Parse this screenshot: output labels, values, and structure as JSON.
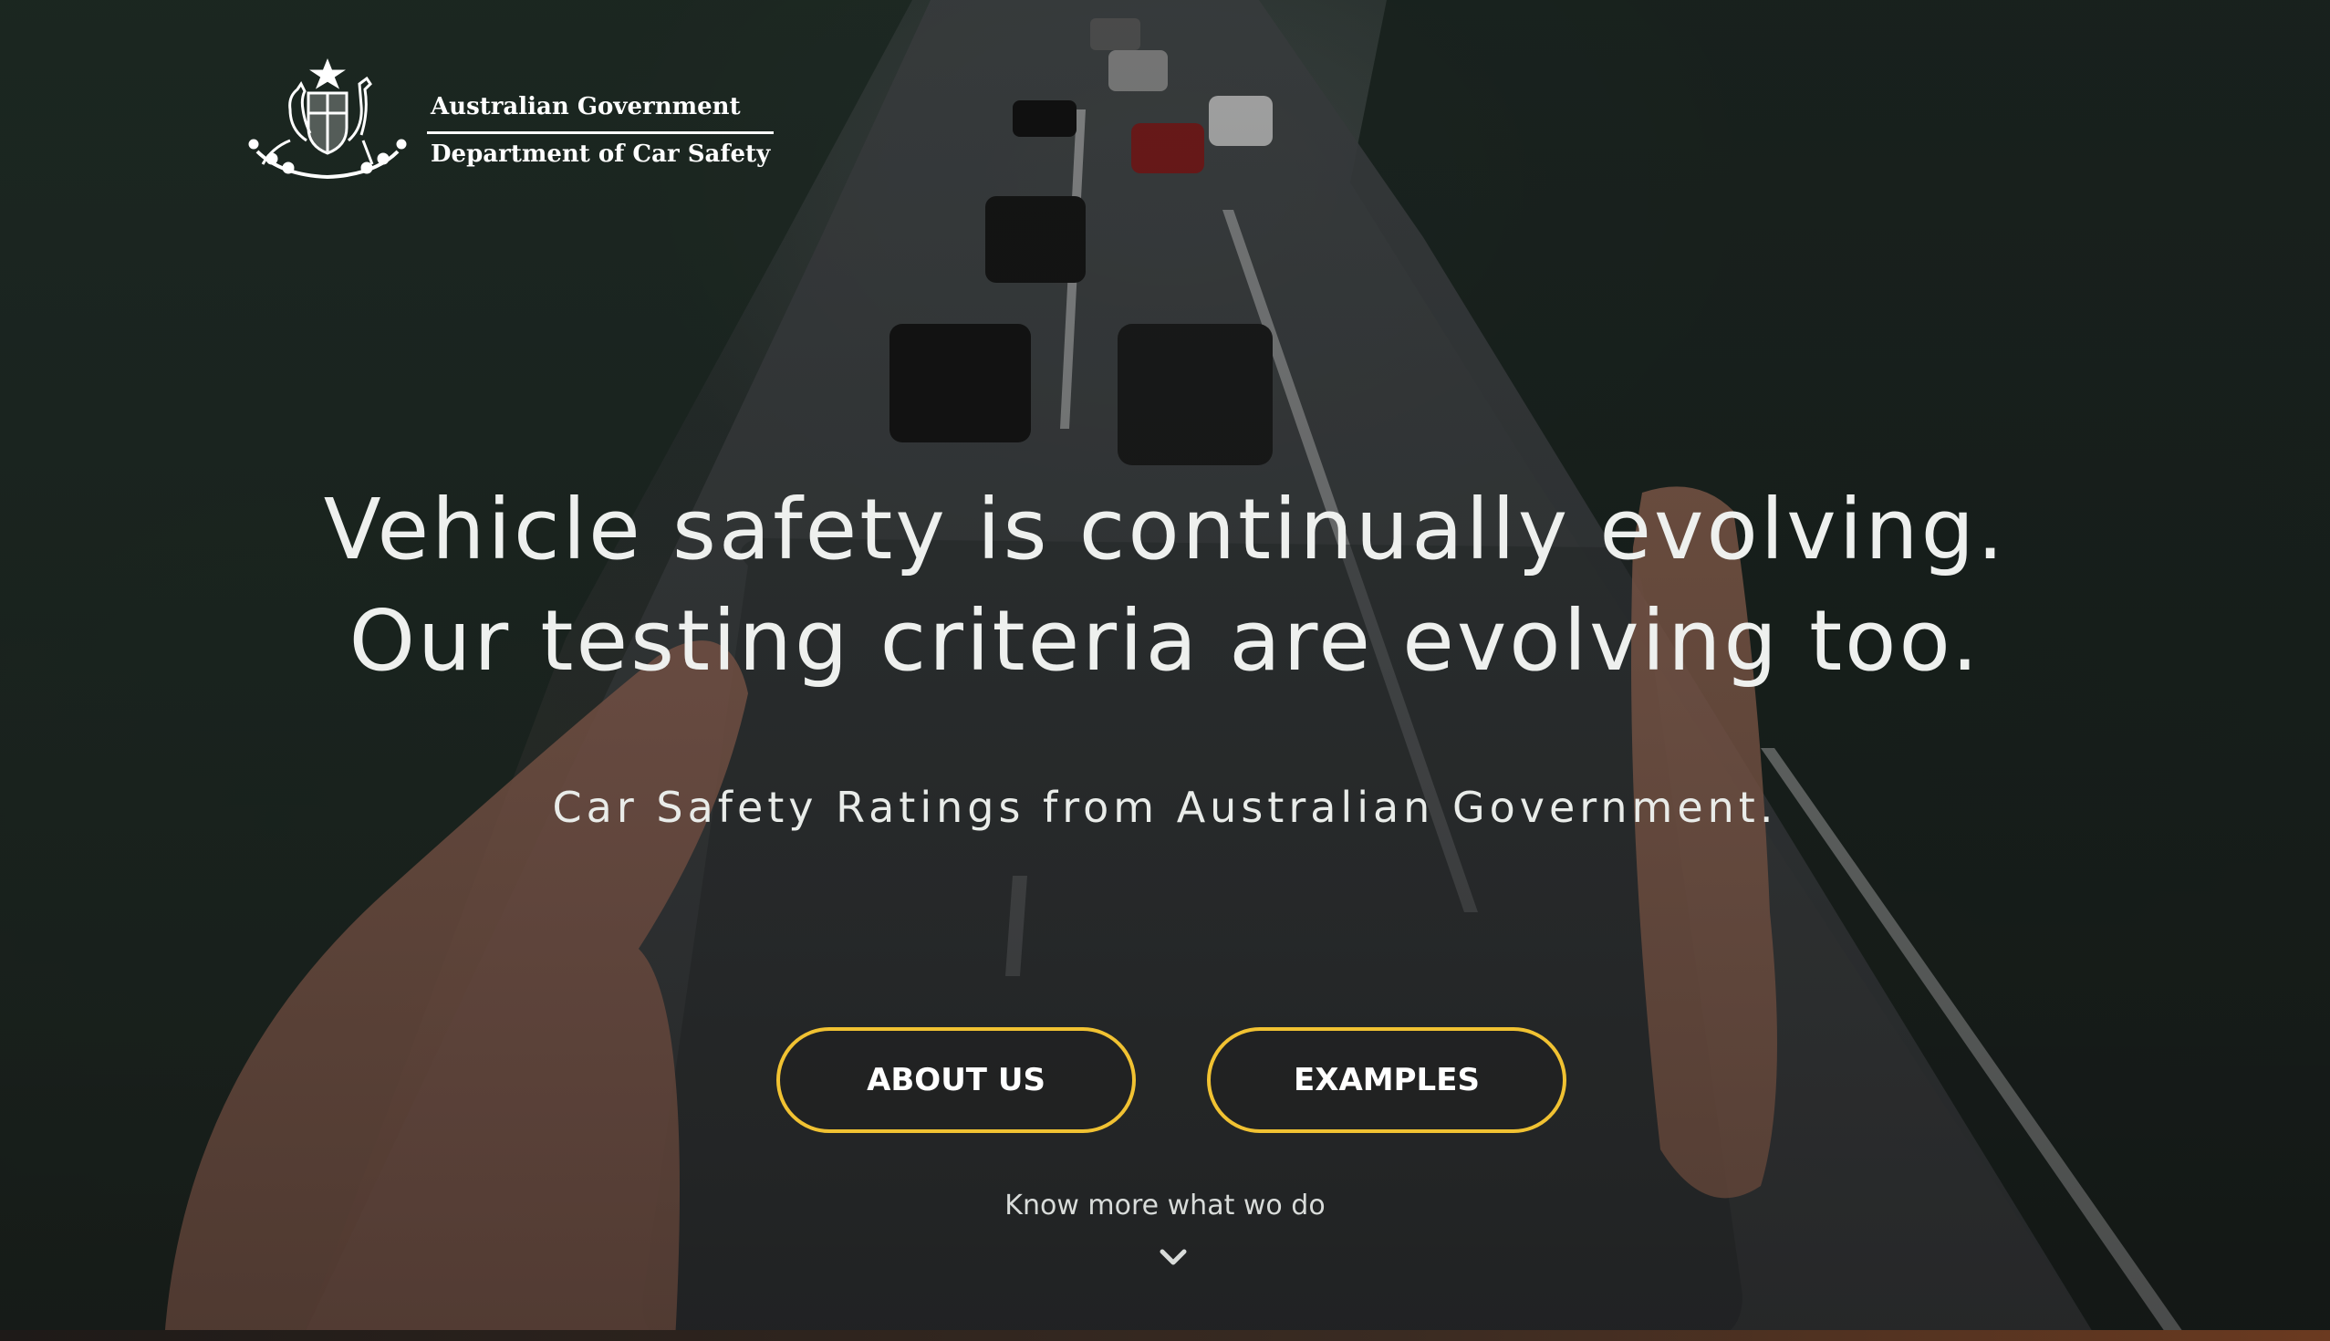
{
  "logo": {
    "line_1": "Australian Government",
    "line_2": "Department of Car Safety",
    "crest_icon": "coat-of-arms-icon"
  },
  "hero": {
    "headline_line_1": "Vehicle safety is continually evolving.",
    "headline_line_2": "Our testing criteria are evolving too.",
    "subtitle": "Car Safety Ratings from Australian Government.",
    "about_label": "ABOUT US",
    "examples_label": "EXAMPLES",
    "know_more": "Know more what wo do",
    "chevron_icon": "chevron-down-icon"
  },
  "colors": {
    "accent": "#f1c232",
    "text": "#ffffff"
  }
}
